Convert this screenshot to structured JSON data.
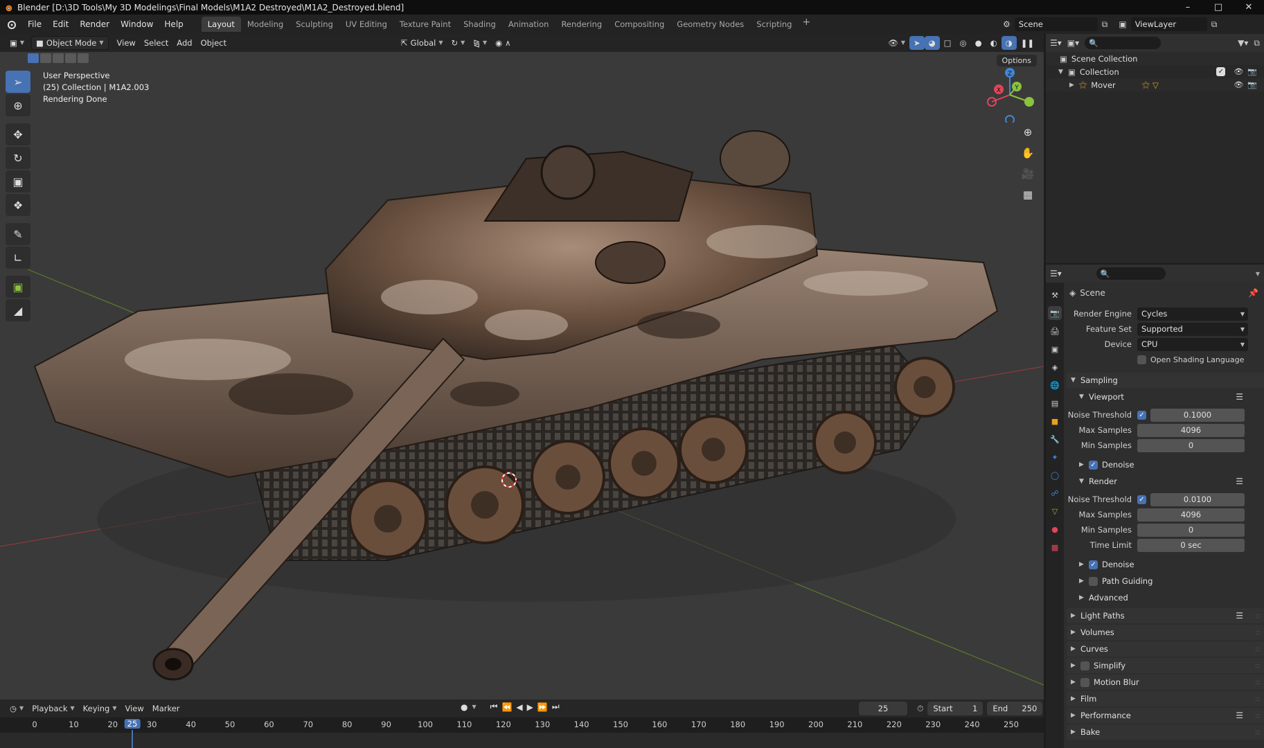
{
  "window": {
    "title": "Blender [D:\\3D Tools\\My 3D Modelings\\Final Models\\M1A2 Destroyed\\M1A2_Destroyed.blend]",
    "controls": [
      "–",
      "□",
      "✕"
    ]
  },
  "menu": [
    "File",
    "Edit",
    "Render",
    "Window",
    "Help"
  ],
  "workspaces": [
    "Layout",
    "Modeling",
    "Sculpting",
    "UV Editing",
    "Texture Paint",
    "Shading",
    "Animation",
    "Rendering",
    "Compositing",
    "Geometry Nodes",
    "Scripting"
  ],
  "workspace_add": "+",
  "active_workspace": "Layout",
  "scene_name": "Scene",
  "view_layer": "ViewLayer",
  "viewport": {
    "mode": "Object Mode",
    "menus": [
      "View",
      "Select",
      "Add",
      "Object"
    ],
    "transform_orientation": "Global",
    "options_label": "Options",
    "info_lines": [
      "User Perspective",
      "(25) Collection | M1A2.003",
      "Rendering Done"
    ],
    "gizmo_axes": {
      "x": "X",
      "y": "Y",
      "z": "Z"
    }
  },
  "timeline": {
    "menus": [
      "Playback",
      "Keying",
      "View",
      "Marker"
    ],
    "current_frame": "25",
    "start_label": "Start",
    "start": "1",
    "end_label": "End",
    "end": "250",
    "ticks": [
      "0",
      "10",
      "20",
      "30",
      "40",
      "50",
      "60",
      "70",
      "80",
      "90",
      "100",
      "110",
      "120",
      "130",
      "140",
      "150",
      "160",
      "170",
      "180",
      "190",
      "200",
      "210",
      "220",
      "230",
      "240",
      "250"
    ]
  },
  "outliner": {
    "scene_collection": "Scene Collection",
    "collection": "Collection",
    "items": [
      "Mover"
    ]
  },
  "properties": {
    "context": "Scene",
    "render_engine_label": "Render Engine",
    "render_engine": "Cycles",
    "feature_set_label": "Feature Set",
    "feature_set": "Supported",
    "device_label": "Device",
    "device": "CPU",
    "osl_label": "Open Shading Language",
    "sampling": "Sampling",
    "viewport_panel": "Viewport",
    "vp_noise_threshold_label": "Noise Threshold",
    "vp_noise_threshold": "0.1000",
    "vp_max_samples_label": "Max Samples",
    "vp_max_samples": "4096",
    "vp_min_samples_label": "Min Samples",
    "vp_min_samples": "0",
    "vp_denoise": "Denoise",
    "render_panel": "Render",
    "r_noise_threshold_label": "Noise Threshold",
    "r_noise_threshold": "0.0100",
    "r_max_samples_label": "Max Samples",
    "r_max_samples": "4096",
    "r_min_samples_label": "Min Samples",
    "r_min_samples": "0",
    "r_time_limit_label": "Time Limit",
    "r_time_limit": "0 sec",
    "r_denoise": "Denoise",
    "path_guiding": "Path Guiding",
    "advanced": "Advanced",
    "panels": [
      "Light Paths",
      "Volumes",
      "Curves",
      "Simplify",
      "Motion Blur",
      "Film",
      "Performance",
      "Bake"
    ]
  },
  "colors": {
    "accent": "#4772b3",
    "axis_x": "#e0455a",
    "axis_y": "#8bc23f",
    "axis_z": "#3f86d8",
    "viewport_bg": "#3a3a3a"
  }
}
